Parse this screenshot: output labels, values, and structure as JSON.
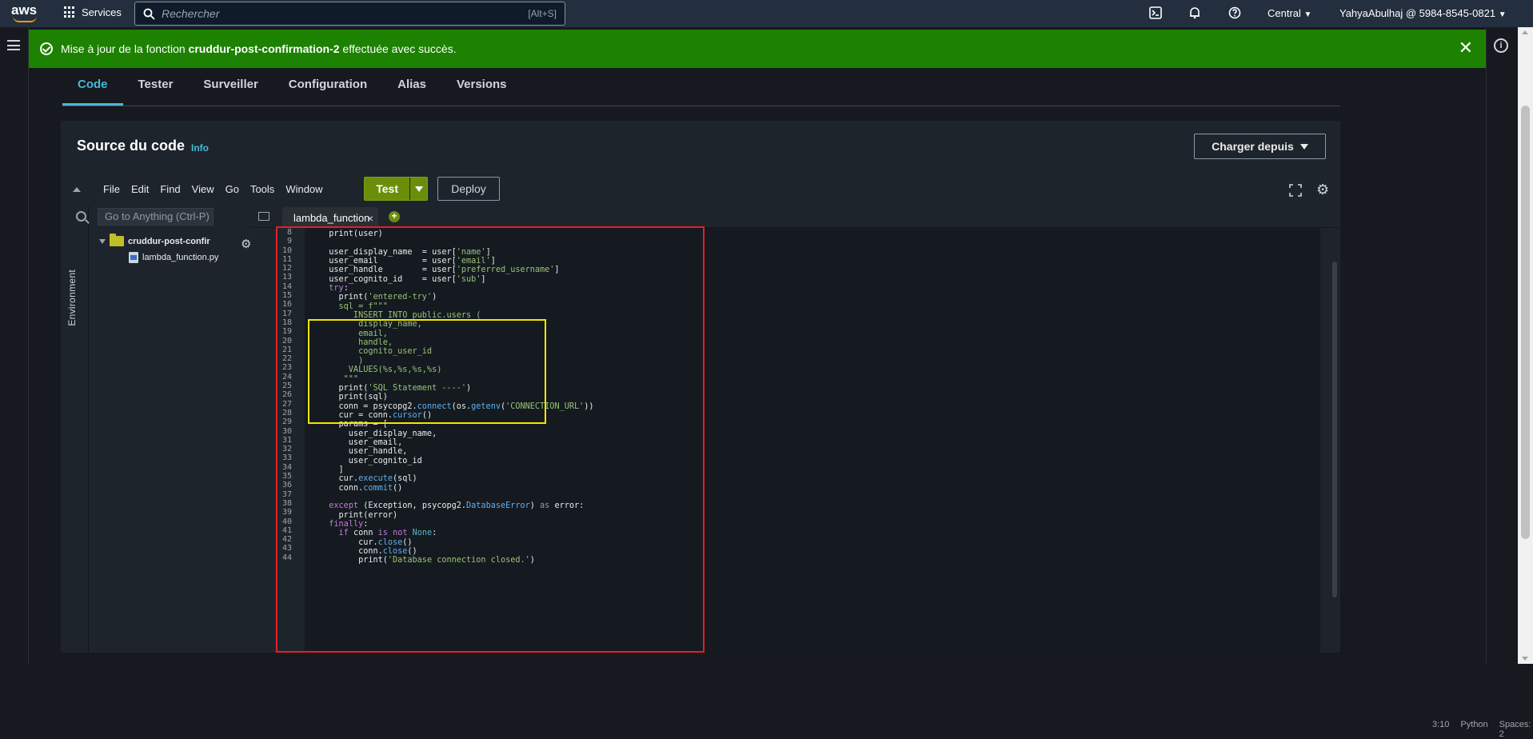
{
  "topbar": {
    "logo": "aws",
    "services_label": "Services",
    "search_placeholder": "Rechercher",
    "search_shortcut": "[Alt+S]",
    "region": "Central",
    "account": "YahyaAbulhaj @ 5984-8545-0821"
  },
  "flash": {
    "prefix": "Mise à jour de la fonction ",
    "function_name": "cruddur-post-confirmation-2",
    "suffix": " effectuée avec succès.",
    "color": "#1d8102"
  },
  "tabs": [
    "Code",
    "Tester",
    "Surveiller",
    "Configuration",
    "Alias",
    "Versions"
  ],
  "active_tab": "Code",
  "source": {
    "title": "Source du code",
    "info_link": "Info",
    "upload_button": "Charger depuis"
  },
  "ide": {
    "menu": [
      "File",
      "Edit",
      "Find",
      "View",
      "Go",
      "Tools",
      "Window"
    ],
    "test_button": "Test",
    "deploy_button": "Deploy",
    "tree_search_placeholder": "Go to Anything (Ctrl-P)",
    "environment_label": "Environment",
    "folder_name": "cruddur-post-confir",
    "file_name": "lambda_function.py",
    "open_tab": "lambda_function",
    "status": {
      "cursor": "3:10",
      "language": "Python",
      "spaces": "Spaces: 2"
    }
  },
  "code": {
    "line_numbers": [
      "8",
      "9",
      "10",
      "11",
      "12",
      "13",
      "14",
      "15",
      "16",
      "17",
      "18",
      "19",
      "20",
      "21",
      "22",
      "23",
      "24",
      "25",
      "26",
      "27",
      "28",
      "29",
      "30",
      "31",
      "32",
      "33",
      "34",
      "35",
      "36",
      "37",
      "38",
      "39",
      "40",
      "41",
      "42",
      "43",
      "44"
    ],
    "lines": [
      "  print(user)",
      "",
      "  user_display_name  = user['name']",
      "  user_email         = user['email']",
      "  user_handle        = user['preferred_username']",
      "  user_cognito_id    = user['sub']",
      "  try:",
      "    print('entered-try')",
      "    sql = f\"\"\"",
      "       INSERT INTO public.users (",
      "        display_name,",
      "        email,",
      "        handle,",
      "        cognito_user_id",
      "        )",
      "      VALUES(%s,%s,%s,%s)",
      "     \"\"\"",
      "    print('SQL Statement ----')",
      "    print(sql)",
      "    conn = psycopg2.connect(os.getenv('CONNECTION_URL'))",
      "    cur = conn.cursor()",
      "    params = [",
      "      user_display_name,",
      "      user_email,",
      "      user_handle,",
      "      user_cognito_id",
      "    ]",
      "    cur.execute(sql)",
      "    conn.commit()",
      "",
      "  except (Exception, psycopg2.DatabaseError) as error:",
      "    print(error)",
      "  finally:",
      "    if conn is not None:",
      "        cur.close()",
      "        conn.close()",
      "        print('Database connection closed.')"
    ]
  },
  "annotations": {
    "red_box_color": "#e51e25",
    "yellow_box_color": "#f3e700"
  },
  "colors": {
    "accent": "#44b9d6",
    "success": "#1d8102",
    "test_button": "#6b8e0a"
  }
}
